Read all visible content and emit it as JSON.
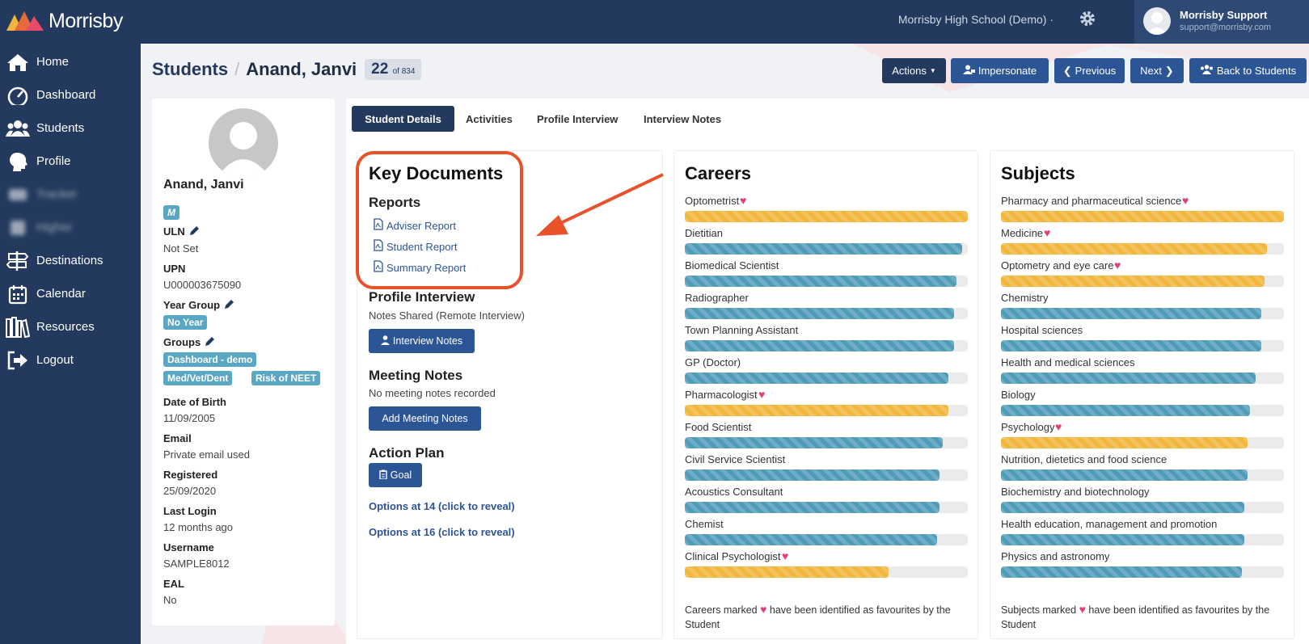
{
  "app": {
    "brand": "Morrisby",
    "school": "Morrisby High School (Demo) ·",
    "user_name": "Morrisby Support",
    "user_email": "support@morrisby.com"
  },
  "sidebar": {
    "items": [
      {
        "label": "Home",
        "icon": "home-icon"
      },
      {
        "label": "Dashboard",
        "icon": "dashboard-icon"
      },
      {
        "label": "Students",
        "icon": "users-icon"
      },
      {
        "label": "Profile",
        "icon": "head-profile-icon"
      },
      {
        "label": "Tracker",
        "icon": "tracker-icon",
        "blurred": true
      },
      {
        "label": "Higher",
        "icon": "higher-icon",
        "blurred": true
      },
      {
        "label": "Destinations",
        "icon": "signpost-icon"
      },
      {
        "label": "Calendar",
        "icon": "calendar-icon"
      },
      {
        "label": "Resources",
        "icon": "books-icon"
      },
      {
        "label": "Logout",
        "icon": "logout-icon"
      }
    ]
  },
  "header": {
    "crumb": "Students",
    "separator": "/",
    "name": "Anand, Janvi",
    "position": "22",
    "total": "of 834",
    "buttons": {
      "actions": "Actions",
      "impersonate": "Impersonate",
      "previous": "Previous",
      "next": "Next",
      "back": "Back to Students"
    }
  },
  "student": {
    "name": "Anand, Janvi",
    "gender": "M",
    "uln_label": "ULN",
    "uln": "Not Set",
    "upn_label": "UPN",
    "upn": "U000003675090",
    "year_group_label": "Year Group",
    "year_group": "No Year",
    "groups_label": "Groups",
    "groups": [
      "Dashboard - demo",
      "Med/Vet/Dent",
      "Risk of NEET"
    ],
    "dob_label": "Date of Birth",
    "dob": "11/09/2005",
    "email_label": "Email",
    "email": "Private email used",
    "registered_label": "Registered",
    "registered": "25/09/2020",
    "last_login_label": "Last Login",
    "last_login": "12 months ago",
    "username_label": "Username",
    "username": "SAMPLE8012",
    "eal_label": "EAL",
    "eal": "No"
  },
  "tabs": [
    "Student Details",
    "Activities",
    "Profile Interview",
    "Interview Notes"
  ],
  "key_documents": {
    "title": "Key Documents",
    "reports_title": "Reports",
    "reports": [
      "Adviser Report",
      "Student Report",
      "Summary Report"
    ],
    "profile_interview_title": "Profile Interview",
    "profile_interview_text": "Notes Shared (Remote Interview)",
    "interview_notes_btn": "Interview Notes",
    "meeting_notes_title": "Meeting Notes",
    "meeting_notes_text": "No meeting notes recorded",
    "add_meeting_btn": "Add Meeting Notes",
    "action_plan_title": "Action Plan",
    "goal_btn": "Goal",
    "options14": "Options at 14 (click to reveal)",
    "options16": "Options at 16 (click to reveal)"
  },
  "colors": {
    "favourite": "#f2b63c",
    "normal": "#4f9bb8",
    "nav": "#233a5e",
    "button": "#2c5596",
    "highlight": "#e8522a"
  },
  "careers": {
    "title": "Careers",
    "note_pre": "Careers marked",
    "note_post": "have been identified as favourites by the Student",
    "items": [
      {
        "label": "Optometrist",
        "fav": true,
        "value": 1.0
      },
      {
        "label": "Dietitian",
        "fav": false,
        "value": 0.98
      },
      {
        "label": "Biomedical Scientist",
        "fav": false,
        "value": 0.96
      },
      {
        "label": "Radiographer",
        "fav": false,
        "value": 0.95
      },
      {
        "label": "Town Planning Assistant",
        "fav": false,
        "value": 0.95
      },
      {
        "label": "GP (Doctor)",
        "fav": false,
        "value": 0.93
      },
      {
        "label": "Pharmacologist",
        "fav": true,
        "value": 0.93
      },
      {
        "label": "Food Scientist",
        "fav": false,
        "value": 0.91
      },
      {
        "label": "Civil Service Scientist",
        "fav": false,
        "value": 0.9
      },
      {
        "label": "Acoustics Consultant",
        "fav": false,
        "value": 0.9
      },
      {
        "label": "Chemist",
        "fav": false,
        "value": 0.89
      },
      {
        "label": "Clinical Psychologist",
        "fav": true,
        "value": 0.72
      }
    ]
  },
  "subjects": {
    "title": "Subjects",
    "note_pre": "Subjects marked",
    "note_post": "have been identified as favourites by the Student",
    "items": [
      {
        "label": "Pharmacy and pharmaceutical science",
        "fav": true,
        "value": 1.0
      },
      {
        "label": "Medicine",
        "fav": true,
        "value": 0.94
      },
      {
        "label": "Optometry and eye care",
        "fav": true,
        "value": 0.93
      },
      {
        "label": "Chemistry",
        "fav": false,
        "value": 0.92
      },
      {
        "label": "Hospital sciences",
        "fav": false,
        "value": 0.92
      },
      {
        "label": "Health and medical sciences",
        "fav": false,
        "value": 0.9
      },
      {
        "label": "Biology",
        "fav": false,
        "value": 0.88
      },
      {
        "label": "Psychology",
        "fav": true,
        "value": 0.87
      },
      {
        "label": "Nutrition, dietetics and food science",
        "fav": false,
        "value": 0.87
      },
      {
        "label": "Biochemistry and biotechnology",
        "fav": false,
        "value": 0.86
      },
      {
        "label": "Health education, management and promotion",
        "fav": false,
        "value": 0.86
      },
      {
        "label": "Physics and astronomy",
        "fav": false,
        "value": 0.85
      }
    ]
  }
}
